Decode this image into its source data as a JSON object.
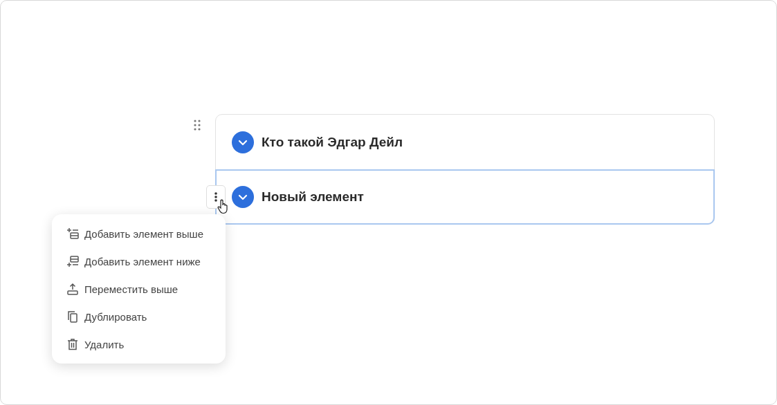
{
  "accordion": {
    "items": [
      {
        "title": "Кто такой Эдгар Дейл",
        "selected": false
      },
      {
        "title": "Новый элемент",
        "selected": true
      }
    ]
  },
  "context_menu": {
    "items": [
      {
        "kind": "add-above",
        "label": "Добавить элемент выше"
      },
      {
        "kind": "add-below",
        "label": "Добавить элемент ниже"
      },
      {
        "kind": "move-up",
        "label": "Переместить выше"
      },
      {
        "kind": "duplicate",
        "label": "Дублировать"
      },
      {
        "kind": "delete",
        "label": "Удалить"
      }
    ]
  }
}
